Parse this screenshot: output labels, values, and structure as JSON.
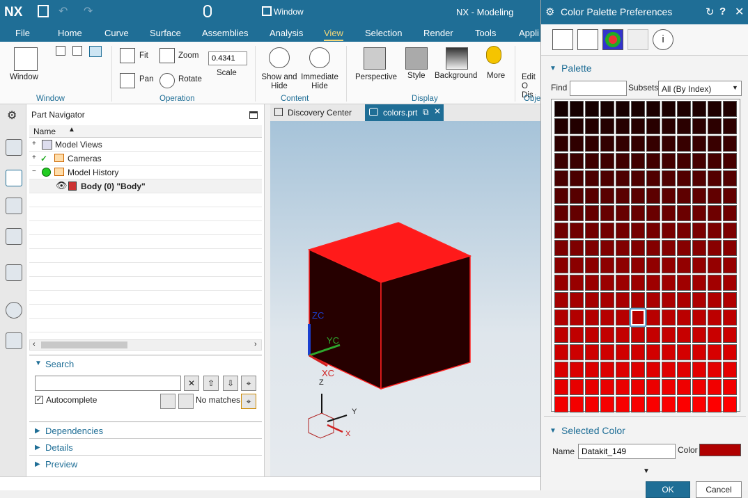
{
  "app": {
    "logo": "NX",
    "title": "NX - Modeling",
    "window_menu": "Window"
  },
  "menus": [
    "File",
    "Home",
    "Curve",
    "Surface",
    "Assemblies",
    "Analysis",
    "View",
    "Selection",
    "Render",
    "Tools",
    "Appli"
  ],
  "ribbon": {
    "window_label": "Window",
    "fit": "Fit",
    "pan": "Pan",
    "zoom": "Zoom",
    "rotate": "Rotate",
    "scale_value": "0.4341",
    "scale_label": "Scale",
    "show_hide": "Show and Hide",
    "immediate_hide": "Immediate Hide",
    "perspective": "Perspective",
    "style": "Style",
    "background": "Background",
    "more": "More",
    "edit_obj": "Edit O Dis",
    "groups": {
      "window": "Window",
      "operation": "Operation",
      "content": "Content",
      "display": "Display",
      "obj": "Obje"
    }
  },
  "navigator": {
    "title": "Part Navigator",
    "col_name": "Name",
    "rows": [
      "Model Views",
      "Cameras",
      "Model History",
      "Body (0) \"Body\""
    ],
    "search_title": "Search",
    "search_placeholder": "",
    "autocomplete": "Autocomplete",
    "no_matches": "No matches",
    "sections": [
      "Dependencies",
      "Details",
      "Preview"
    ]
  },
  "tabs": {
    "discovery": "Discovery Center",
    "part": "colors.prt"
  },
  "viewport": {
    "zc": "ZC",
    "yc": "YC",
    "xc": "XC",
    "z": "Z",
    "y": "Y",
    "x": "X",
    "cube_top_color": "#ff1a1a",
    "cube_side_color": "#260000"
  },
  "dialog": {
    "title": "Color Palette Preferences",
    "palette_title": "Palette",
    "find_label": "Find",
    "find_value": "",
    "subsets_label": "Subsets",
    "subsets_value": "All (By Index)",
    "selected_title": "Selected Color",
    "name_label": "Name",
    "name_value": "Datakit_149",
    "color_label": "Color",
    "selected_color": "#b00000",
    "selected_row": 12,
    "selected_col": 5,
    "ok": "OK",
    "cancel": "Cancel"
  }
}
